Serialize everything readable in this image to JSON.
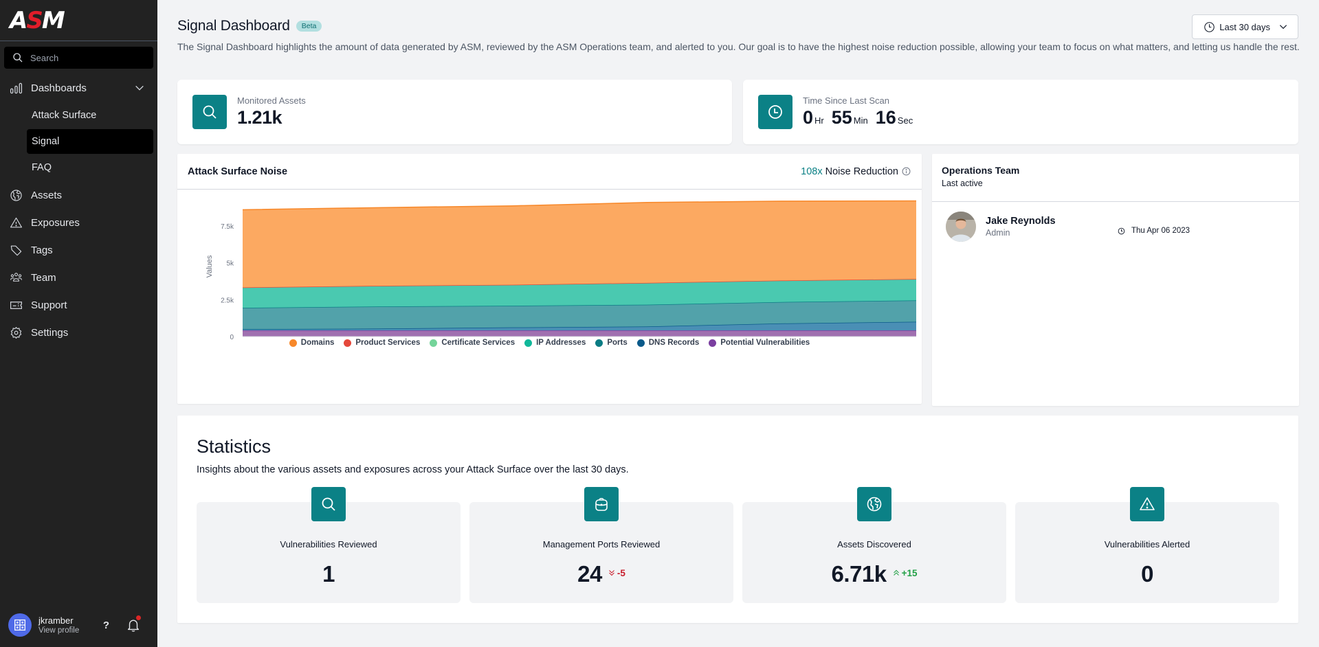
{
  "sidebar": {
    "logo": {
      "part1": "A",
      "part2": "S",
      "part3": "M"
    },
    "search_placeholder": "Search",
    "items": [
      {
        "label": "Dashboards",
        "icon": "bar-chart-icon",
        "expanded": true,
        "children": [
          {
            "label": "Attack Surface",
            "active": false
          },
          {
            "label": "Signal",
            "active": true
          },
          {
            "label": "FAQ",
            "active": false
          }
        ]
      },
      {
        "label": "Assets",
        "icon": "globe-icon"
      },
      {
        "label": "Exposures",
        "icon": "warning-icon"
      },
      {
        "label": "Tags",
        "icon": "tag-icon"
      },
      {
        "label": "Team",
        "icon": "team-icon"
      },
      {
        "label": "Support",
        "icon": "ticket-icon"
      },
      {
        "label": "Settings",
        "icon": "gear-icon"
      }
    ],
    "profile": {
      "username": "jkramber",
      "link": "View profile",
      "help": "?",
      "has_notification": true
    }
  },
  "header": {
    "title": "Signal Dashboard",
    "badge": "Beta",
    "description": "The Signal Dashboard highlights the amount of data generated by ASM, reviewed by the ASM Operations team, and alerted to you. Our goal is to have the highest noise reduction possible, allowing your team to focus on what matters, and letting us handle the rest.",
    "range_selector": "Last 30 days"
  },
  "kpis": {
    "monitored_assets": {
      "label": "Monitored Assets",
      "value": "1.21k"
    },
    "last_scan": {
      "label": "Time Since Last Scan",
      "hours": "0",
      "hours_unit": "Hr",
      "minutes": "55",
      "minutes_unit": "Min",
      "seconds": "16",
      "seconds_unit": "Sec"
    }
  },
  "noise_card": {
    "title": "Attack Surface Noise",
    "reduction_value": "108x",
    "reduction_label": "Noise Reduction"
  },
  "chart_data": {
    "type": "area",
    "stacked": true,
    "title": "Attack Surface Noise",
    "xlabel": "",
    "ylabel": "Values",
    "ylim": [
      0,
      9500
    ],
    "yticks": [
      0,
      2500,
      5000,
      7500
    ],
    "ytick_labels": [
      "0",
      "2.5k",
      "5k",
      "7.5k"
    ],
    "grid": true,
    "legend_position": "bottom",
    "x": [
      0,
      1,
      2,
      3,
      4,
      5
    ],
    "series": [
      {
        "name": "Potential Vulnerabilities",
        "color": "#7b3fa0",
        "fill": "#a070b0",
        "values": [
          420,
          420,
          420,
          420,
          420,
          420
        ]
      },
      {
        "name": "DNS Records",
        "color": "#0a5a8a",
        "fill": "#4a8fb5",
        "values": [
          80,
          120,
          200,
          260,
          470,
          580
        ]
      },
      {
        "name": "Ports",
        "color": "#0b7c84",
        "fill": "#52a2aa",
        "values": [
          1450,
          1500,
          1470,
          1480,
          1450,
          1450
        ]
      },
      {
        "name": "IP Addresses",
        "color": "#10b89a",
        "fill": "#4ac9b0",
        "values": [
          1380,
          1400,
          1420,
          1480,
          1460,
          1450
        ]
      },
      {
        "name": "Certificate Services",
        "color": "#74d49a",
        "fill": "#8fdcb0",
        "values": [
          0,
          0,
          0,
          0,
          0,
          0
        ]
      },
      {
        "name": "Product Services",
        "color": "#e5483b",
        "fill": "#ec7e74",
        "values": [
          0,
          0,
          0,
          0,
          0,
          0
        ]
      },
      {
        "name": "Domains",
        "color": "#f7882a",
        "fill": "#fca961",
        "values": [
          5270,
          5300,
          5350,
          5450,
          5380,
          5300
        ]
      }
    ],
    "legend": [
      {
        "name": "Domains",
        "color": "#f7882a"
      },
      {
        "name": "Product Services",
        "color": "#e5483b"
      },
      {
        "name": "Certificate Services",
        "color": "#74d49a"
      },
      {
        "name": "IP Addresses",
        "color": "#10b89a"
      },
      {
        "name": "Ports",
        "color": "#0b7c84"
      },
      {
        "name": "DNS Records",
        "color": "#0a5a8a"
      },
      {
        "name": "Potential Vulnerabilities",
        "color": "#7b3fa0"
      }
    ]
  },
  "operations": {
    "title": "Operations Team",
    "subtitle": "Last active",
    "members": [
      {
        "name": "Jake Reynolds",
        "role": "Admin",
        "last_active": "Thu Apr 06 2023"
      }
    ]
  },
  "statistics": {
    "title": "Statistics",
    "description": "Insights about the various assets and exposures across your Attack Surface over the last 30 days.",
    "items": [
      {
        "label": "Vulnerabilities Reviewed",
        "value": "1",
        "icon": "search-icon",
        "delta": null
      },
      {
        "label": "Management Ports Reviewed",
        "value": "24",
        "icon": "briefcase-icon",
        "delta": "-5",
        "delta_dir": "down"
      },
      {
        "label": "Assets Discovered",
        "value": "6.71k",
        "icon": "globe-icon",
        "delta": "+15",
        "delta_dir": "up"
      },
      {
        "label": "Vulnerabilities Alerted",
        "value": "0",
        "icon": "warning-icon",
        "delta": null
      }
    ]
  },
  "colors": {
    "accent": "#0b8186",
    "sidebar_bg": "#222222",
    "page_bg": "#f2f3f5",
    "delta_down": "#c81e2d",
    "delta_up": "#22a046"
  }
}
